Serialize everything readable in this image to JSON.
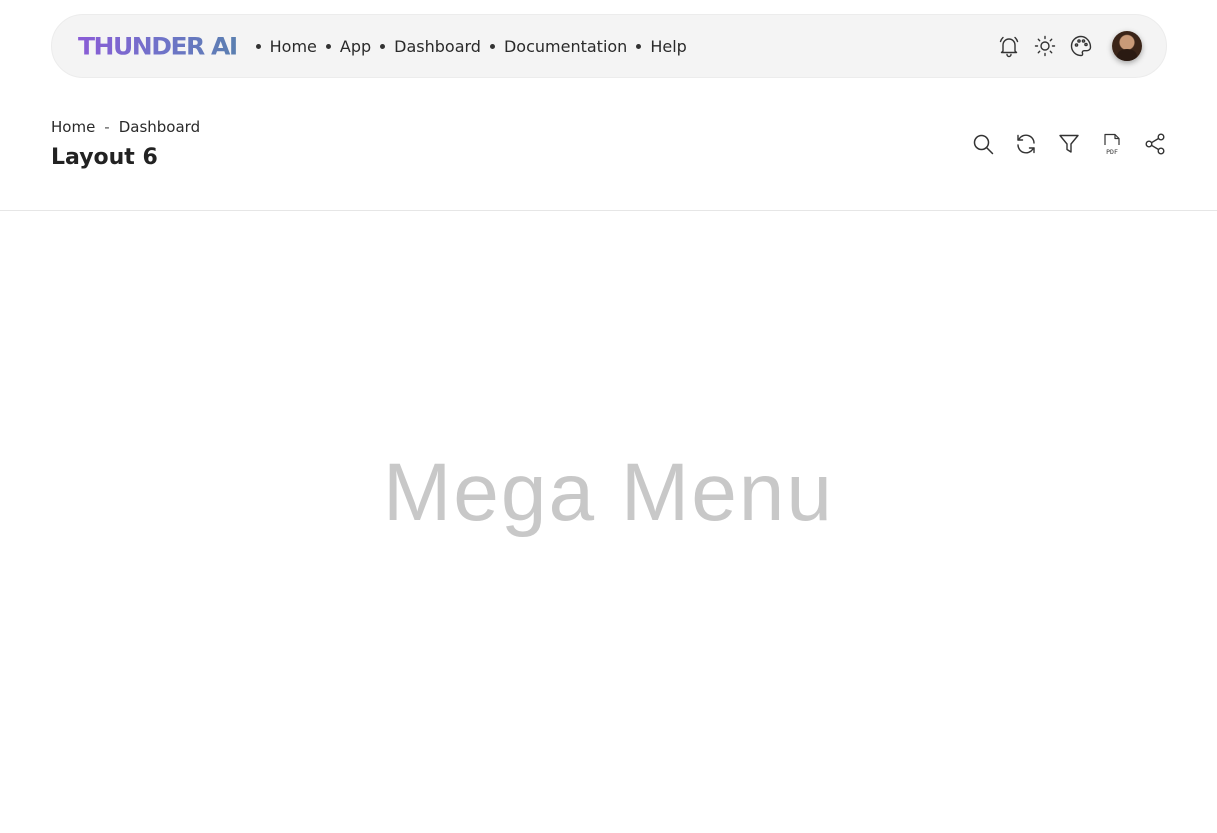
{
  "brand": {
    "logo": "THUNDER AI"
  },
  "nav": {
    "items": [
      {
        "label": "Home"
      },
      {
        "label": "App"
      },
      {
        "label": "Dashboard"
      },
      {
        "label": "Documentation"
      },
      {
        "label": "Help"
      }
    ]
  },
  "top_actions": {
    "icons": [
      "bell-icon",
      "sun-icon",
      "palette-icon",
      "user-avatar"
    ]
  },
  "breadcrumb": {
    "home": "Home",
    "separator": "-",
    "current": "Dashboard"
  },
  "page": {
    "title": "Layout 6",
    "placeholder": "Mega Menu"
  },
  "toolbar": {
    "icons": [
      "search-icon",
      "refresh-icon",
      "filter-icon",
      "pdf-icon",
      "share-icon"
    ]
  },
  "colors": {
    "logo_gradient_start": "#8a5cd6",
    "logo_gradient_end": "#5a7fb0",
    "placeholder_text": "#c8c8c8",
    "topbar_bg": "#f4f4f4"
  }
}
